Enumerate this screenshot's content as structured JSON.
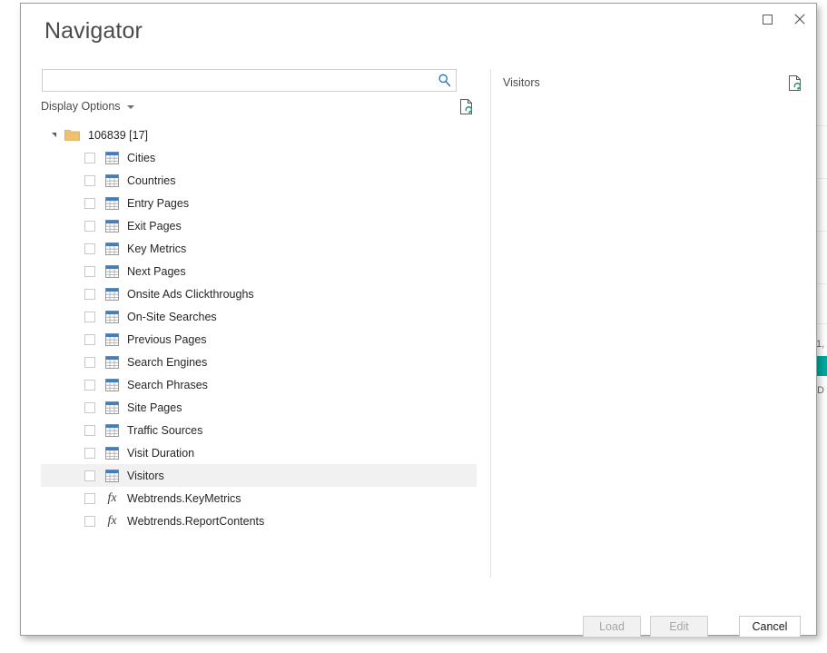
{
  "window": {
    "title": "Navigator",
    "controls": [
      {
        "name": "maximize-button",
        "icon": "maximize-icon",
        "label": "Maximize"
      },
      {
        "name": "close-button",
        "icon": "close-icon",
        "label": "Close"
      }
    ]
  },
  "search": {
    "value": "",
    "placeholder": "",
    "icon": "search-icon",
    "icon_color": "#2a6fb5"
  },
  "display_options": {
    "label": "Display Options",
    "caret_icon": "chevron-down-icon",
    "refresh_icon": "refresh-document-icon"
  },
  "preview": {
    "title": "Visitors",
    "refresh_icon": "refresh-document-icon",
    "refresh_icon_color": "#1e9e7d"
  },
  "tree": {
    "root": {
      "label": "106839 [17]",
      "expanded": true,
      "folder_icon": "folder-icon",
      "twisty_icon": "triangle-expanded-icon"
    },
    "items": [
      {
        "label": "Cities",
        "icon": "table-icon",
        "checked": false,
        "selected": false
      },
      {
        "label": "Countries",
        "icon": "table-icon",
        "checked": false,
        "selected": false
      },
      {
        "label": "Entry Pages",
        "icon": "table-icon",
        "checked": false,
        "selected": false
      },
      {
        "label": "Exit Pages",
        "icon": "table-icon",
        "checked": false,
        "selected": false
      },
      {
        "label": "Key Metrics",
        "icon": "table-icon",
        "checked": false,
        "selected": false
      },
      {
        "label": "Next Pages",
        "icon": "table-icon",
        "checked": false,
        "selected": false
      },
      {
        "label": "Onsite Ads Clickthroughs",
        "icon": "table-icon",
        "checked": false,
        "selected": false
      },
      {
        "label": "On-Site Searches",
        "icon": "table-icon",
        "checked": false,
        "selected": false
      },
      {
        "label": "Previous Pages",
        "icon": "table-icon",
        "checked": false,
        "selected": false
      },
      {
        "label": "Search Engines",
        "icon": "table-icon",
        "checked": false,
        "selected": false
      },
      {
        "label": "Search Phrases",
        "icon": "table-icon",
        "checked": false,
        "selected": false
      },
      {
        "label": "Site Pages",
        "icon": "table-icon",
        "checked": false,
        "selected": false
      },
      {
        "label": "Traffic Sources",
        "icon": "table-icon",
        "checked": false,
        "selected": false
      },
      {
        "label": "Visit Duration",
        "icon": "table-icon",
        "checked": false,
        "selected": false
      },
      {
        "label": "Visitors",
        "icon": "table-icon",
        "checked": false,
        "selected": true
      },
      {
        "label": "Webtrends.KeyMetrics",
        "icon": "function-icon",
        "checked": false,
        "selected": false
      },
      {
        "label": "Webtrends.ReportContents",
        "icon": "function-icon",
        "checked": false,
        "selected": false
      }
    ]
  },
  "footer": {
    "load_label": "Load",
    "load_enabled": false,
    "edit_label": "Edit",
    "edit_enabled": false,
    "cancel_label": "Cancel",
    "cancel_enabled": true
  },
  "background": {
    "number_text": "1,",
    "letter_text": "D",
    "bar_color": "#01a79d"
  }
}
